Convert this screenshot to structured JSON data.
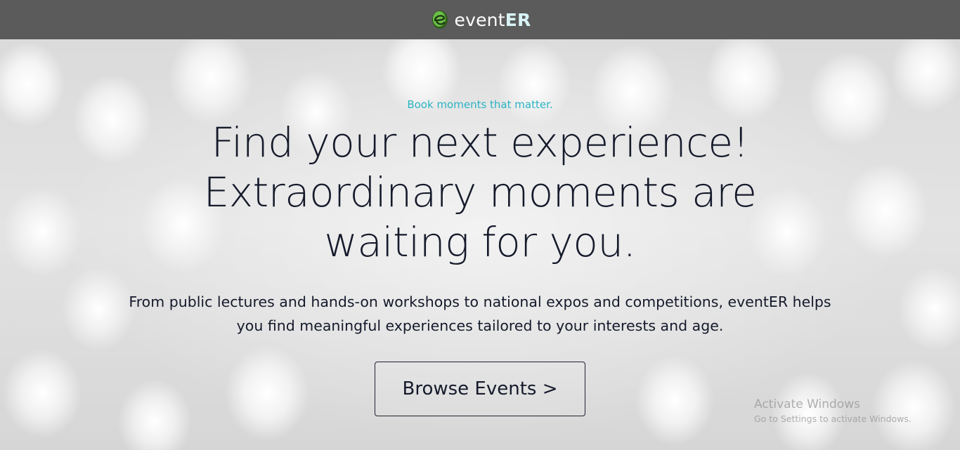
{
  "header": {
    "logo_icon": "leaf-e-icon",
    "brand_prefix": "event",
    "brand_suffix": "ER"
  },
  "hero": {
    "tagline": "Book moments that matter.",
    "headline": "Find your next experience! Extraordinary moments are waiting for you.",
    "description": "From public lectures and hands-on workshops to national expos and competitions, eventER helps you find meaningful experiences tailored to your interests and age.",
    "cta_label": "Browse Events >"
  },
  "watermark": {
    "title": "Activate Windows",
    "subtitle": "Go to Settings to activate Windows."
  },
  "colors": {
    "header_bg": "#5b5b5b",
    "accent": "#2bb3c4",
    "text": "#151a2b",
    "logo_green": "#6cc04a"
  }
}
